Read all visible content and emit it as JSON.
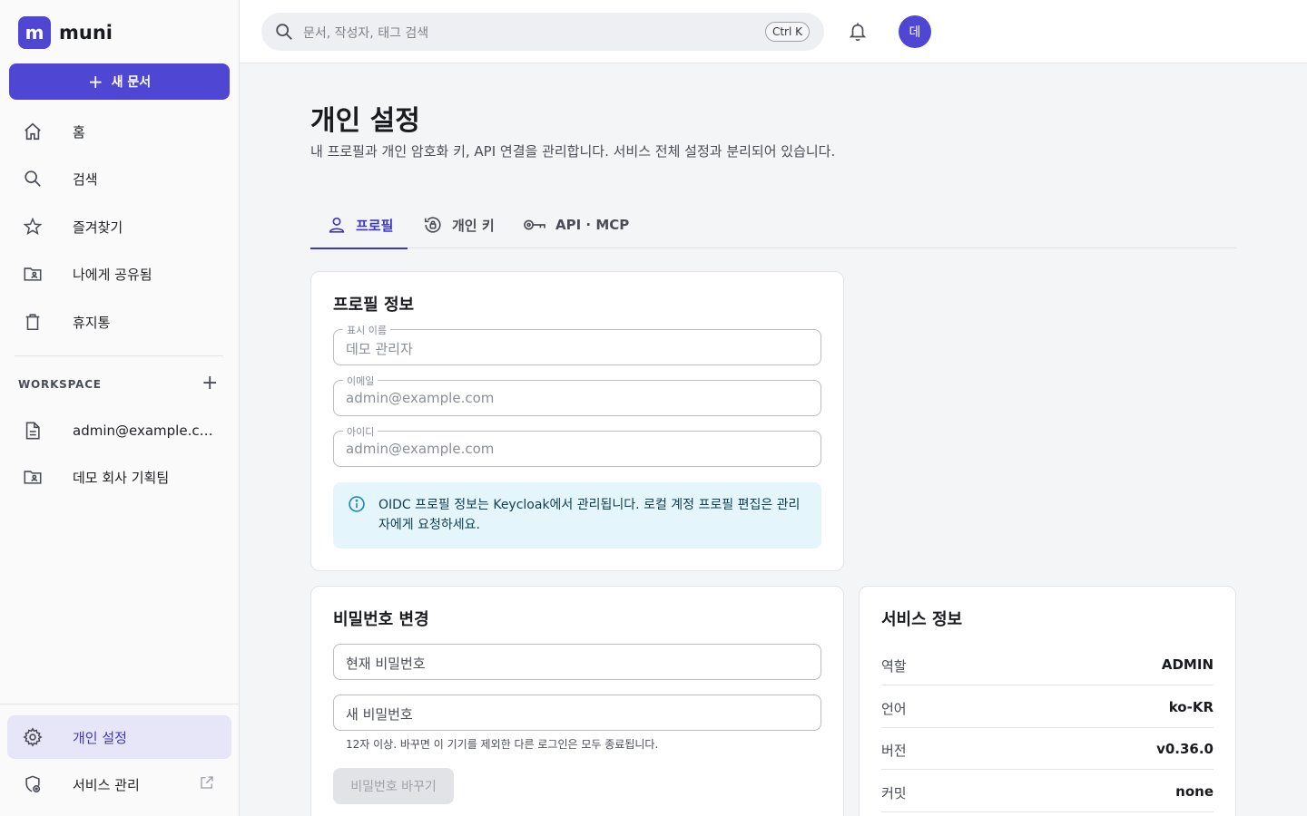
{
  "brand": {
    "logo_letter": "m",
    "name": "muni"
  },
  "sidebar": {
    "new_doc_label": "새 문서",
    "nav": [
      {
        "label": "홈",
        "icon": "home-icon"
      },
      {
        "label": "검색",
        "icon": "search-icon"
      },
      {
        "label": "즐겨찾기",
        "icon": "star-icon"
      },
      {
        "label": "나에게 공유됨",
        "icon": "shared-folder-icon"
      },
      {
        "label": "휴지통",
        "icon": "trash-icon"
      }
    ],
    "workspace_label": "WORKSPACE",
    "workspaces": [
      {
        "label": "admin@example.com",
        "icon": "document-icon"
      },
      {
        "label": "데모 회사 기획팀",
        "icon": "shared-folder-icon"
      }
    ],
    "bottom": [
      {
        "label": "개인 설정",
        "icon": "gear-icon",
        "active": true
      },
      {
        "label": "서비스 관리",
        "icon": "shield-gear-icon",
        "external": true
      }
    ]
  },
  "topbar": {
    "search_placeholder": "문서, 작성자, 태그 검색",
    "shortcut": "Ctrl K",
    "avatar_letter": "데"
  },
  "page": {
    "title": "개인 설정",
    "subtitle": "내 프로필과 개인 암호화 키, API 연결을 관리합니다. 서비스 전체 설정과 분리되어 있습니다."
  },
  "tabs": [
    {
      "label": "프로필",
      "icon": "user-icon",
      "active": true
    },
    {
      "label": "개인 키",
      "icon": "key-lock-icon",
      "active": false
    },
    {
      "label": "API · MCP",
      "icon": "key-icon",
      "active": false
    }
  ],
  "profile": {
    "title": "프로필 정보",
    "fields": [
      {
        "label": "표시 이름",
        "value": "데모 관리자"
      },
      {
        "label": "이메일",
        "value": "admin@example.com"
      },
      {
        "label": "아이디",
        "value": "admin@example.com"
      }
    ],
    "notice": "OIDC 프로필 정보는 Keycloak에서 관리됩니다. 로컬 계정 프로필 편집은 관리자에게 요청하세요."
  },
  "password": {
    "title": "비밀번호 변경",
    "current_placeholder": "현재 비밀번호",
    "new_placeholder": "새 비밀번호",
    "hint": "12자 이상. 바꾸면 이 기기를 제외한 다른 로그인은 모두 종료됩니다.",
    "submit_label": "비밀번호 바꾸기"
  },
  "service": {
    "title": "서비스 정보",
    "rows": [
      {
        "key": "역할",
        "value": "ADMIN"
      },
      {
        "key": "언어",
        "value": "ko-KR"
      },
      {
        "key": "버전",
        "value": "v0.36.0"
      },
      {
        "key": "커밋",
        "value": "none"
      }
    ]
  },
  "colors": {
    "accent": "#5046d4",
    "accent_text": "#4036c4",
    "info_bg": "#e4f5fb",
    "info_icon": "#1a8bc4"
  }
}
